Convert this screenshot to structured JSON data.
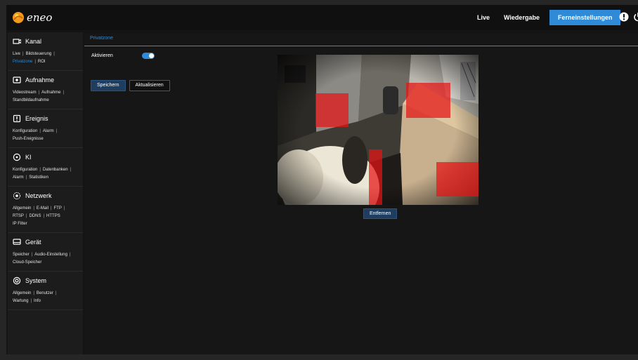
{
  "brand": {
    "name": "eneo"
  },
  "topnav": {
    "items": [
      {
        "label": "Live",
        "active": false
      },
      {
        "label": "Wiedergabe",
        "active": false
      },
      {
        "label": "Ferneinstellungen",
        "active": true
      }
    ]
  },
  "colors": {
    "accent": "#2f8ad8",
    "mask": "#e61414",
    "background": "#141414"
  },
  "sidebar": {
    "sections": [
      {
        "title": "Kanal",
        "icon": "camera-icon",
        "lines": [
          [
            "Live",
            "Bildsteuerung"
          ],
          [
            "Privatzone",
            "ROI"
          ]
        ],
        "active": "Privatzone"
      },
      {
        "title": "Aufnahme",
        "icon": "record-icon",
        "lines": [
          [
            "Videostream",
            "Aufnahme"
          ],
          [
            "Standbildaufnahme"
          ]
        ]
      },
      {
        "title": "Ereignis",
        "icon": "event-icon",
        "lines": [
          [
            "Konfiguration",
            "Alarm"
          ],
          [
            "Push-Ereignisse"
          ]
        ]
      },
      {
        "title": "KI",
        "icon": "ai-icon",
        "lines": [
          [
            "Konfiguration",
            "Datenbanken"
          ],
          [
            "Alarm",
            "Statistiken"
          ]
        ]
      },
      {
        "title": "Netzwerk",
        "icon": "network-icon",
        "lines": [
          [
            "Allgemein",
            "E-Mail",
            "FTP"
          ],
          [
            "RTSP",
            "DDNS",
            "HTTPS"
          ],
          [
            "IP Filter"
          ]
        ]
      },
      {
        "title": "Gerät",
        "icon": "device-icon",
        "lines": [
          [
            "Speicher",
            "Audio-Einstellung"
          ],
          [
            "Cloud-Speicher"
          ]
        ]
      },
      {
        "title": "System",
        "icon": "system-icon",
        "lines": [
          [
            "Allgemein",
            "Benutzer"
          ],
          [
            "Wartung",
            "Info"
          ]
        ]
      }
    ]
  },
  "main": {
    "tab": "Privatzone",
    "enable_label": "Aktivieren",
    "enabled": true,
    "save_label": "Speichern",
    "refresh_label": "Aktualisieren",
    "remove_label": "Entfernen",
    "privacy_zone_count": 4
  }
}
